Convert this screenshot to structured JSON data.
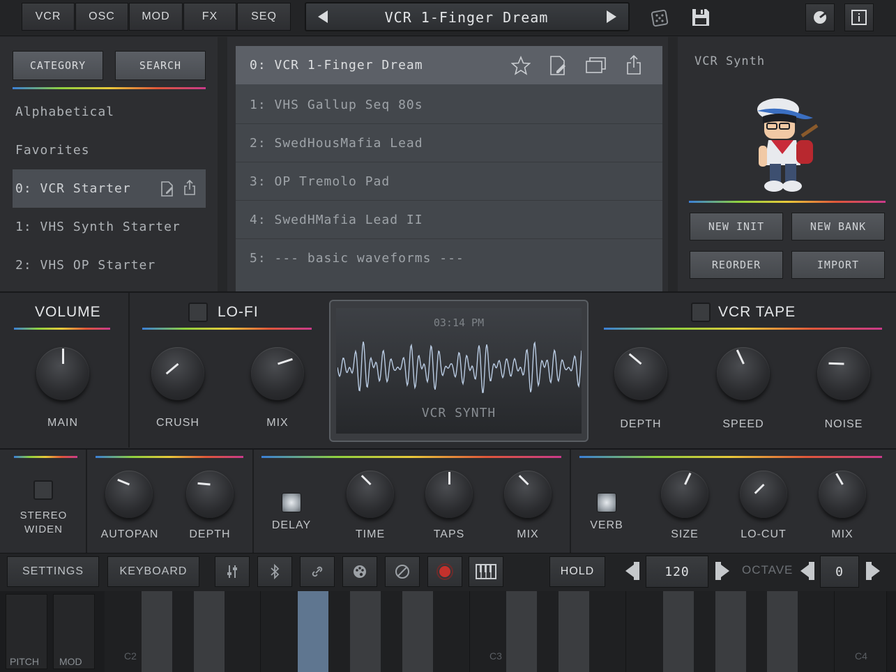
{
  "topbar": {
    "tabs": [
      "VCR",
      "OSC",
      "MOD",
      "FX",
      "SEQ"
    ],
    "preset_name": "VCR 1-Finger Dream",
    "icons": [
      "dice-icon",
      "save-icon",
      "record-midi-icon",
      "info-icon"
    ]
  },
  "browser": {
    "category_label": "CATEGORY",
    "search_label": "SEARCH",
    "left_items": [
      "Alphabetical",
      "Favorites",
      "0: VCR Starter",
      "1: VHS Synth Starter",
      "2: VHS OP Starter"
    ],
    "presets": [
      "0: VCR 1-Finger Dream",
      "1: VHS Gallup Seq 80s",
      "2: SwedHousMafia Lead",
      "3: OP Tremolo Pad",
      "4: SwedHMafia Lead II",
      "5: --- basic waveforms ---"
    ],
    "bank_title": "VCR Synth",
    "buttons": [
      "NEW INIT",
      "NEW BANK",
      "REORDER",
      "IMPORT"
    ]
  },
  "fx_top": {
    "volume_title": "VOLUME",
    "lofi_title": "LO-FI",
    "vcrtape_title": "VCR TAPE",
    "knobs": {
      "main": "MAIN",
      "crush": "CRUSH",
      "mix": "MIX",
      "depth": "DEPTH",
      "speed": "SPEED",
      "noise": "NOISE"
    },
    "screen_time": "03:14 PM",
    "screen_label": "VCR SYNTH"
  },
  "fx_bottom": {
    "stereo_label": "STEREO WIDEN",
    "autopan": "AUTOPAN",
    "depth": "DEPTH",
    "delay": "DELAY",
    "time": "TIME",
    "taps": "TAPS",
    "mix1": "MIX",
    "verb": "VERB",
    "size": "SIZE",
    "locut": "LO-CUT",
    "mix2": "MIX"
  },
  "controls": {
    "settings": "SETTINGS",
    "keyboard": "KEYBOARD",
    "hold": "HOLD",
    "tempo": "120",
    "octave_label": "OCTAVE",
    "octave": "0"
  },
  "keys": {
    "pitch": "PITCH",
    "mod": "MOD",
    "c2": "C2",
    "c3": "C3",
    "c4": "C4"
  }
}
